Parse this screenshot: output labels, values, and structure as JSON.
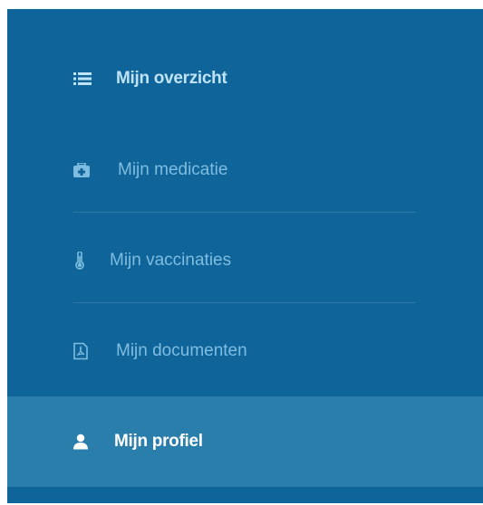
{
  "nav": {
    "items": [
      {
        "label": "Mijn overzicht",
        "icon": "list-icon"
      },
      {
        "label": "Mijn medicatie",
        "icon": "first-aid-kit-icon"
      },
      {
        "label": "Mijn vaccinaties",
        "icon": "thermometer-icon"
      },
      {
        "label": "Mijn documenten",
        "icon": "pdf-document-icon"
      },
      {
        "label": "Mijn profiel",
        "icon": "user-icon",
        "active": true
      }
    ]
  },
  "colors": {
    "sidebar_bg": "#0f6499",
    "active_bg": "#2a7eac",
    "muted_text": "#7fbde0",
    "highlight_text": "#bfe3f6"
  }
}
